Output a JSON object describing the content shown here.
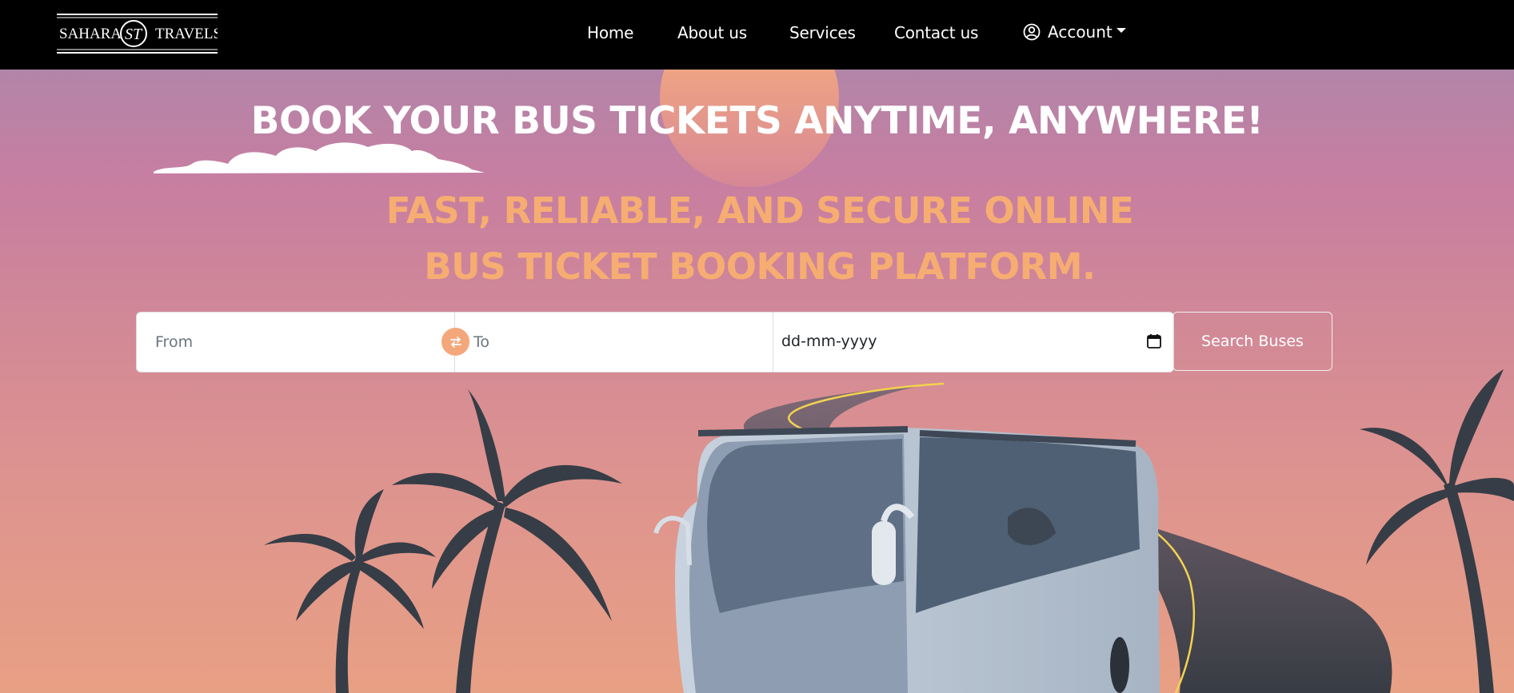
{
  "brand": {
    "logo_left": "SAHARA",
    "logo_right": "TRAVELS",
    "logo_monogram": "ST"
  },
  "nav": {
    "items": [
      {
        "label": "Home"
      },
      {
        "label": "About us"
      },
      {
        "label": "Services"
      },
      {
        "label": "Contact us"
      }
    ],
    "account_label": "Account",
    "account_icon": "user-circle-icon",
    "dropdown_icon": "caret-down-icon"
  },
  "hero": {
    "headline": "BOOK YOUR BUS TICKETS ANYTIME, ANYWHERE!",
    "subheadline": "FAST, RELIABLE, AND SECURE ONLINE BUS TICKET BOOKING PLATFORM."
  },
  "search": {
    "from_placeholder": "From",
    "to_placeholder": "To",
    "date_value": "dd-mm-yyyy",
    "swap_icon": "swap-arrows-icon",
    "calendar_icon": "calendar-icon",
    "button_label": "Search Buses"
  },
  "colors": {
    "navbar": "#000000",
    "headline": "#ffffff",
    "subheadline": "#f6ad72",
    "swap_button": "#f4a77b",
    "palm": "#363d46"
  }
}
